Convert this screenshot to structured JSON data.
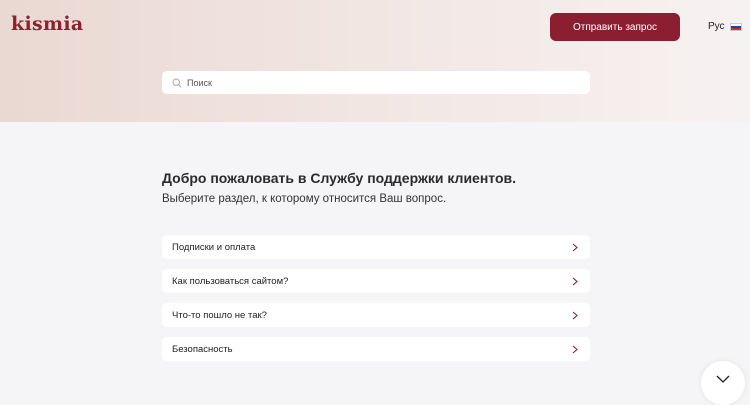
{
  "header": {
    "logo_text": "kismia",
    "send_request_label": "Отправить запрос",
    "language": {
      "label": "Рус",
      "flag_colors": [
        "#ffffff",
        "#1c3fa8",
        "#d52b1e"
      ]
    }
  },
  "search": {
    "placeholder": "Поиск",
    "value": ""
  },
  "main": {
    "title": "Добро пожаловать в Службу поддержки клиентов.",
    "subtitle": "Выберите раздел, к которому относится Ваш вопрос.",
    "categories": [
      {
        "label": "Подписки и оплата"
      },
      {
        "label": "Как пользоваться сайтом?"
      },
      {
        "label": "Что-то пошло не так?"
      },
      {
        "label": "Безопасность"
      }
    ]
  },
  "icons": {
    "search": "search-icon",
    "chevron": "chevron-right-icon",
    "fab": "chevron-down-icon"
  },
  "colors": {
    "brand": "#8b1e30",
    "hero_start": "#ead8d2",
    "hero_end": "#f7f2f2",
    "page_bg": "#f5f5f8"
  }
}
